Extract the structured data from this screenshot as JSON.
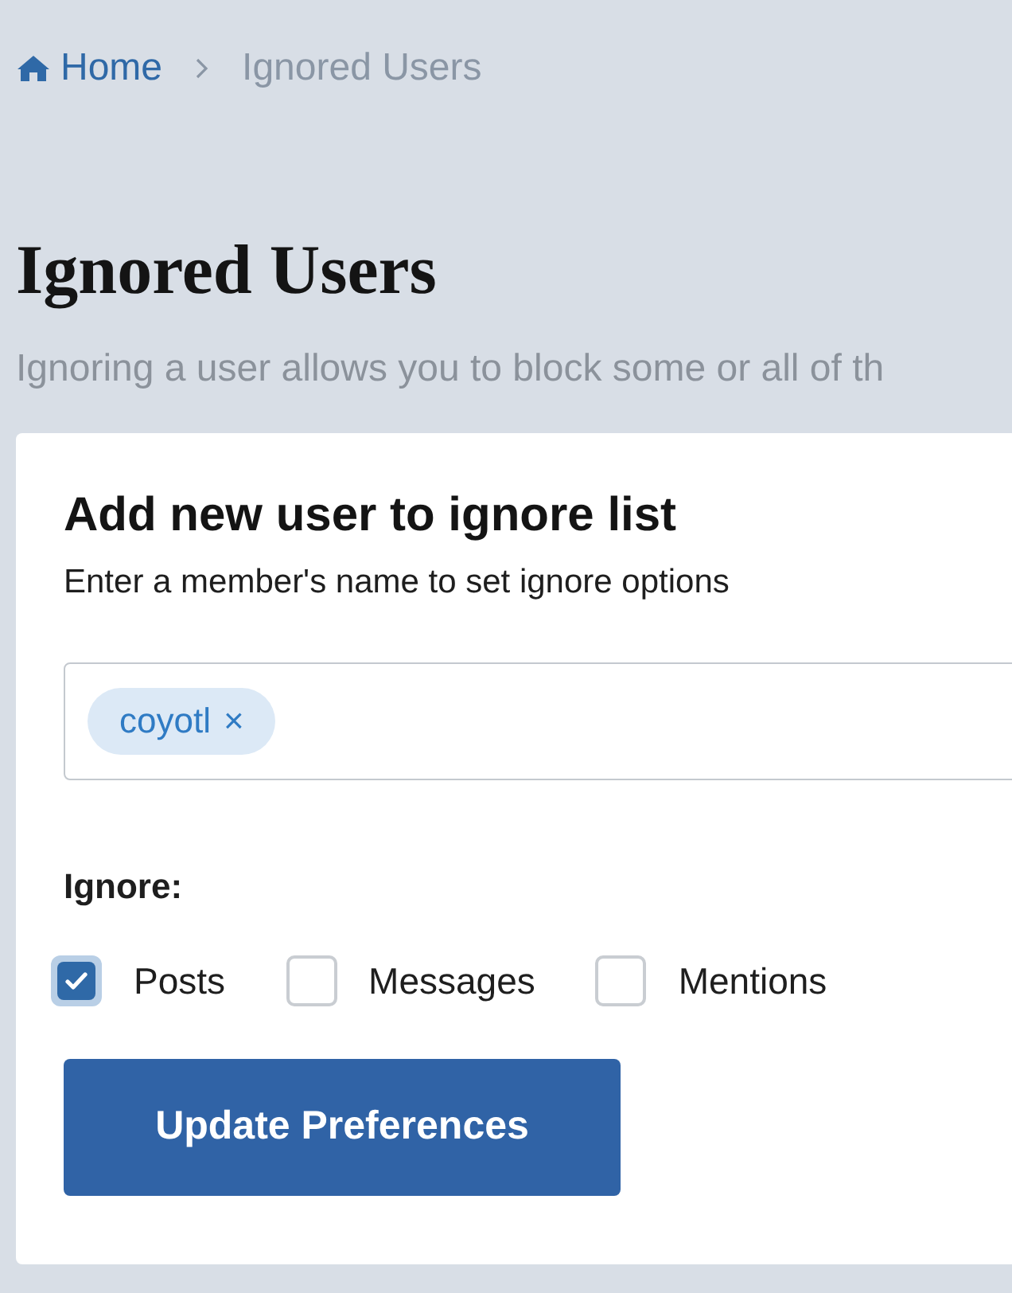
{
  "breadcrumb": [
    {
      "label": "Home",
      "kind": "link"
    },
    {
      "label": "Ignored Users",
      "kind": "current"
    }
  ],
  "page": {
    "title": "Ignored Users",
    "description": "Ignoring a user allows you to block some or all of th"
  },
  "form": {
    "title": "Add new user to ignore list",
    "subtitle": "Enter a member's name to set ignore options",
    "tokens": [
      {
        "label": "coyotl",
        "remove": "×"
      }
    ],
    "ignore_label": "Ignore:",
    "options": [
      {
        "label": "Posts",
        "checked": true
      },
      {
        "label": "Messages",
        "checked": false
      },
      {
        "label": "Mentions",
        "checked": false
      }
    ],
    "submit": "Update Preferences"
  }
}
